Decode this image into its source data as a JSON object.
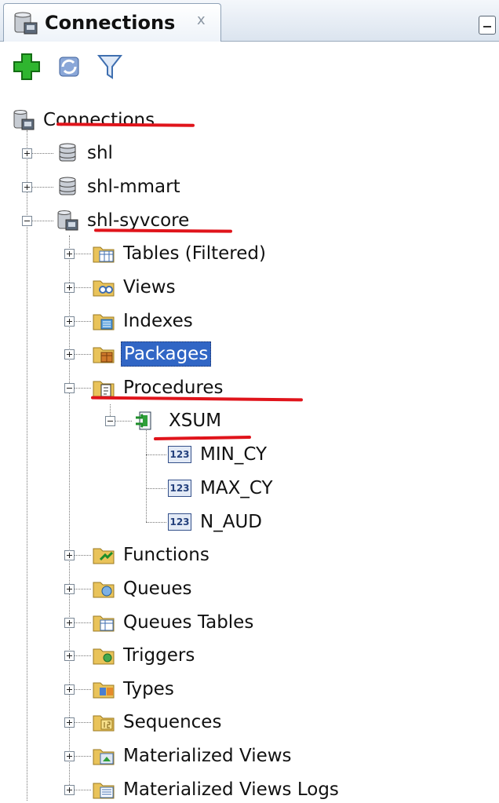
{
  "tab": {
    "label": "Connections",
    "close": "x"
  },
  "toolbar": {
    "buttons": [
      {
        "name": "add-connection",
        "icon": "green-plus-icon"
      },
      {
        "name": "refresh",
        "icon": "refresh-icon"
      },
      {
        "name": "filter",
        "icon": "funnel-icon"
      }
    ]
  },
  "tree": {
    "root": "Connections",
    "connections": [
      "shl",
      "shl-mmart",
      "shl-syvcore"
    ],
    "categories_top": [
      "Tables (Filtered)",
      "Views",
      "Indexes",
      "Packages",
      "Procedures"
    ],
    "procedure": "XSUM",
    "params": [
      "MIN_CY",
      "MAX_CY",
      "N_AUD"
    ],
    "categories_bottom": [
      "Functions",
      "Queues",
      "Queues Tables",
      "Triggers",
      "Types",
      "Sequences",
      "Materialized Views",
      "Materialized Views Logs"
    ],
    "param_icon_text": "123",
    "selected": "Packages"
  },
  "colors": {
    "selection": "#3166c5",
    "annotation": "#e0141b",
    "folder": "#e9c35a"
  }
}
